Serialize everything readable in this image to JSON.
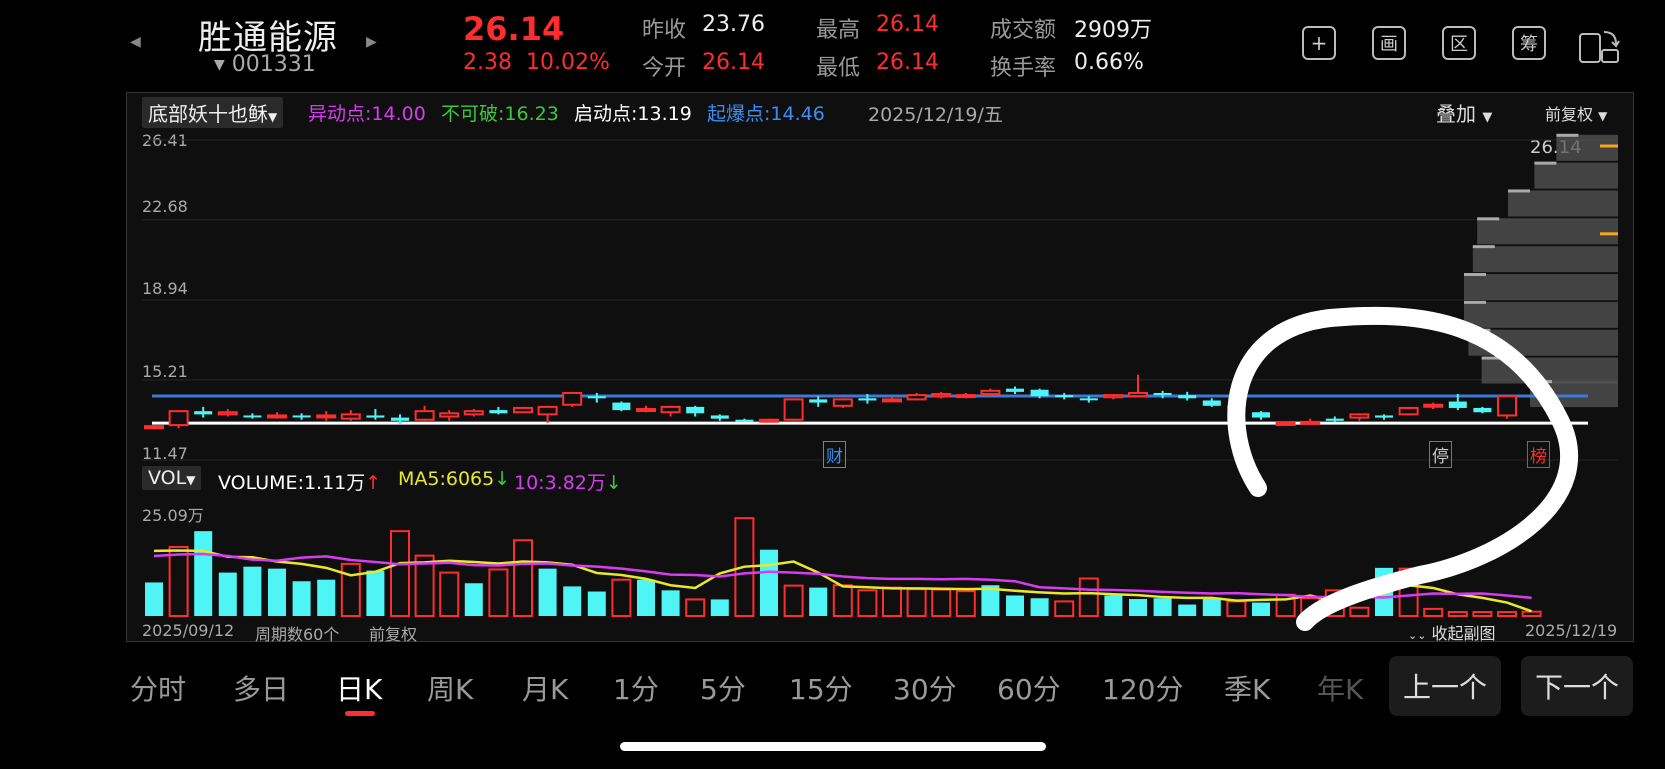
{
  "header": {
    "name": "胜通能源",
    "code": "001331",
    "price": "26.14",
    "change": "2.38",
    "change_pct": "10.02%",
    "prev_close_label": "昨收",
    "prev_close": "23.76",
    "open_label": "今开",
    "open": "26.14",
    "high_label": "最高",
    "high": "26.14",
    "low_label": "最低",
    "low": "26.14",
    "amount_label": "成交额",
    "amount": "2909万",
    "turnover_label": "换手率",
    "turnover": "0.66%",
    "tools": [
      "+",
      "画",
      "区",
      "筹"
    ]
  },
  "indicator_bar": {
    "indicator": "底部妖十也稣",
    "yidong": "异动点:14.00",
    "bukepo": "不可破:16.23",
    "qidong": "启动点:13.19",
    "qibao": "起爆点:14.46",
    "date": "2025/12/19/五",
    "overlay": "叠加",
    "adjust": "前复权"
  },
  "price_axis": {
    "ticks": [
      "26.41",
      "22.68",
      "18.94",
      "15.21",
      "11.47"
    ],
    "last_label": "26.14"
  },
  "markers": {
    "cai": "财",
    "ting": "停",
    "bang": "榜"
  },
  "volume_bar": {
    "selector": "VOL",
    "volume": "VOLUME:1.11万",
    "ma5": "MA5:6065",
    "ma10": "10:3.82万",
    "max_label": "25.09万"
  },
  "footer": {
    "start_date": "2025/09/12",
    "period": "周期数60个",
    "adjust": "前复权",
    "collapse": "收起副图",
    "end_date": "2025/12/19"
  },
  "tabs": [
    "分时",
    "多日",
    "日K",
    "周K",
    "月K",
    "1分",
    "5分",
    "15分",
    "30分",
    "60分",
    "120分",
    "季K",
    "年K"
  ],
  "active_tab": "日K",
  "nav": {
    "prev": "上一个",
    "next": "下一个"
  },
  "colors": {
    "up": "#ff2d2d",
    "down": "#4ff5f5",
    "ma5": "#e8e82a",
    "ma10": "#d83cf0",
    "blue_line": "#3a7bd5"
  },
  "chart_data": {
    "type": "candlestick",
    "ylim": [
      11.47,
      26.41
    ],
    "hlines": [
      {
        "value": 14.46,
        "color": "#3a7bd5"
      },
      {
        "value": 13.19,
        "color": "#ffffff"
      }
    ],
    "candles": [
      [
        13.0,
        13.05,
        12.9,
        13.1
      ],
      [
        13.1,
        13.75,
        12.95,
        13.8
      ],
      [
        13.75,
        13.6,
        13.45,
        13.95
      ],
      [
        13.6,
        13.7,
        13.5,
        13.85
      ],
      [
        13.55,
        13.5,
        13.4,
        13.65
      ],
      [
        13.5,
        13.55,
        13.4,
        13.7
      ],
      [
        13.55,
        13.5,
        13.35,
        13.65
      ],
      [
        13.5,
        13.55,
        13.3,
        13.75
      ],
      [
        13.4,
        13.6,
        13.3,
        13.8
      ],
      [
        13.55,
        13.45,
        13.35,
        13.85
      ],
      [
        13.45,
        13.3,
        13.15,
        13.6
      ],
      [
        13.35,
        13.75,
        13.3,
        14.0
      ],
      [
        13.5,
        13.65,
        13.3,
        13.8
      ],
      [
        13.6,
        13.75,
        13.5,
        13.85
      ],
      [
        13.8,
        13.65,
        13.6,
        13.95
      ],
      [
        13.7,
        13.9,
        13.65,
        13.95
      ],
      [
        13.6,
        13.95,
        13.2,
        14.0
      ],
      [
        14.05,
        14.6,
        13.95,
        14.65
      ],
      [
        14.45,
        14.35,
        14.15,
        14.6
      ],
      [
        14.15,
        13.8,
        13.75,
        14.2
      ],
      [
        13.8,
        13.85,
        13.7,
        14.0
      ],
      [
        13.7,
        13.95,
        13.5,
        14.0
      ],
      [
        13.95,
        13.65,
        13.5,
        14.0
      ],
      [
        13.55,
        13.4,
        13.3,
        13.6
      ],
      [
        13.35,
        13.3,
        13.25,
        13.4
      ],
      [
        13.3,
        13.35,
        13.25,
        13.4
      ],
      [
        13.35,
        14.3,
        13.3,
        14.3
      ],
      [
        14.3,
        14.15,
        13.95,
        14.45
      ],
      [
        14.0,
        14.3,
        13.9,
        14.35
      ],
      [
        14.35,
        14.25,
        14.1,
        14.55
      ],
      [
        14.25,
        14.3,
        14.2,
        14.4
      ],
      [
        14.3,
        14.5,
        14.25,
        14.6
      ],
      [
        14.45,
        14.55,
        14.35,
        14.65
      ],
      [
        14.45,
        14.5,
        14.35,
        14.6
      ],
      [
        14.55,
        14.7,
        14.45,
        14.8
      ],
      [
        14.8,
        14.65,
        14.55,
        14.9
      ],
      [
        14.75,
        14.45,
        14.35,
        14.8
      ],
      [
        14.5,
        14.4,
        14.3,
        14.6
      ],
      [
        14.35,
        14.3,
        14.15,
        14.45
      ],
      [
        14.4,
        14.5,
        14.3,
        14.55
      ],
      [
        14.45,
        14.6,
        14.4,
        15.45
      ],
      [
        14.6,
        14.5,
        14.35,
        14.7
      ],
      [
        14.5,
        14.35,
        14.25,
        14.65
      ],
      [
        14.25,
        14.0,
        13.95,
        14.35
      ],
      [
        14.0,
        13.8,
        13.75,
        14.1
      ],
      [
        13.7,
        13.45,
        13.35,
        13.75
      ],
      [
        13.2,
        13.2,
        13.15,
        13.25
      ],
      [
        13.2,
        13.25,
        13.15,
        13.4
      ],
      [
        13.4,
        13.3,
        13.25,
        13.5
      ],
      [
        13.45,
        13.6,
        13.3,
        13.65
      ],
      [
        13.55,
        13.45,
        13.35,
        13.6
      ],
      [
        13.6,
        13.9,
        13.55,
        13.95
      ],
      [
        14.0,
        14.05,
        13.85,
        14.15
      ],
      [
        14.2,
        13.9,
        13.8,
        14.55
      ],
      [
        13.9,
        13.7,
        13.65,
        13.95
      ],
      [
        13.55,
        14.45,
        13.4,
        14.5
      ]
    ],
    "volume": {
      "ylim": [
        0,
        25.09
      ],
      "bars": [
        [
          8.5,
          0
        ],
        [
          17.5,
          1
        ],
        [
          21.5,
          0
        ],
        [
          11,
          0
        ],
        [
          12.5,
          0
        ],
        [
          12,
          0
        ],
        [
          8.8,
          0
        ],
        [
          9.2,
          0
        ],
        [
          13.2,
          1
        ],
        [
          11.5,
          0
        ],
        [
          21.5,
          1
        ],
        [
          15.3,
          1
        ],
        [
          11,
          1
        ],
        [
          8.3,
          0
        ],
        [
          11.8,
          1
        ],
        [
          19.2,
          1
        ],
        [
          12,
          0
        ],
        [
          7.5,
          0
        ],
        [
          6.2,
          0
        ],
        [
          9.2,
          1
        ],
        [
          9.2,
          0
        ],
        [
          6.5,
          0
        ],
        [
          4.2,
          1
        ],
        [
          4.2,
          0
        ],
        [
          24.8,
          1
        ],
        [
          16.8,
          0
        ],
        [
          7.7,
          1
        ],
        [
          7.2,
          0
        ],
        [
          7.8,
          1
        ],
        [
          6.5,
          1
        ],
        [
          7.2,
          1
        ],
        [
          6.8,
          1
        ],
        [
          6.7,
          1
        ],
        [
          6.3,
          1
        ],
        [
          7.8,
          0
        ],
        [
          5.2,
          0
        ],
        [
          4.5,
          0
        ],
        [
          3.7,
          1
        ],
        [
          9.5,
          1
        ],
        [
          5.2,
          0
        ],
        [
          4.3,
          0
        ],
        [
          4.5,
          0
        ],
        [
          2.9,
          0
        ],
        [
          4.7,
          0
        ],
        [
          3.7,
          1
        ],
        [
          3.4,
          0
        ],
        [
          5.4,
          1
        ],
        [
          4.5,
          1
        ],
        [
          6.5,
          1
        ],
        [
          2.1,
          1
        ],
        [
          12.2,
          0
        ],
        [
          12.0,
          1
        ],
        [
          1.8,
          1
        ],
        [
          1.0,
          1
        ],
        [
          1.0,
          1
        ],
        [
          1.0,
          1
        ],
        [
          1.1,
          1
        ]
      ],
      "ma5": [
        16.5,
        16.6,
        16.5,
        15,
        14.9,
        13.8,
        13.2,
        12.2,
        10.3,
        11.2,
        13.4,
        13.6,
        14,
        13.7,
        13.3,
        13.8,
        13.6,
        13.0,
        10.9,
        10.4,
        9.4,
        7.8,
        7.1,
        10.8,
        12.5,
        12.9,
        13.8,
        11,
        7.5,
        7.3,
        7.0,
        7.0,
        6.9,
        6.8,
        6.9,
        6.4,
        6.0,
        5.7,
        5.8,
        5.5,
        5.3,
        4.8,
        4.6,
        4.6,
        3.9,
        4.1,
        4.2,
        5.2,
        3.8,
        4.7,
        5.7,
        7.8,
        7.1,
        5.5,
        4.6,
        3.4,
        1.2
      ],
      "ma10": [
        15.2,
        15.6,
        15.7,
        15.2,
        14.3,
        14.0,
        14.8,
        15.1,
        14.2,
        13.7,
        13.1,
        13.3,
        13.5,
        12.9,
        12.8,
        13.2,
        13.3,
        12.8,
        12.5,
        12.0,
        11.3,
        10.5,
        10.4,
        10.0,
        10.8,
        11.2,
        11.0,
        10.7,
        10.0,
        9.6,
        9.4,
        9.4,
        9.3,
        9.4,
        9.2,
        8.8,
        7.3,
        7.0,
        6.7,
        6.6,
        6.4,
        6.1,
        5.9,
        5.7,
        5.8,
        5.5,
        5.3,
        4.8,
        4.8,
        4.8,
        4.7,
        5.2,
        5.7,
        5.6,
        5.7,
        5.2,
        4.6
      ]
    },
    "chips": [
      {
        "price": 26.0,
        "width": 0.28
      },
      {
        "price": 24.7,
        "width": 0.38
      },
      {
        "price": 23.4,
        "width": 0.5
      },
      {
        "price": 22.1,
        "width": 0.64
      },
      {
        "price": 20.8,
        "width": 0.66
      },
      {
        "price": 19.5,
        "width": 0.7
      },
      {
        "price": 18.2,
        "width": 0.7
      },
      {
        "price": 16.9,
        "width": 0.68
      },
      {
        "price": 15.6,
        "width": 0.62
      },
      {
        "price": 14.5,
        "width": 0.4
      }
    ]
  }
}
